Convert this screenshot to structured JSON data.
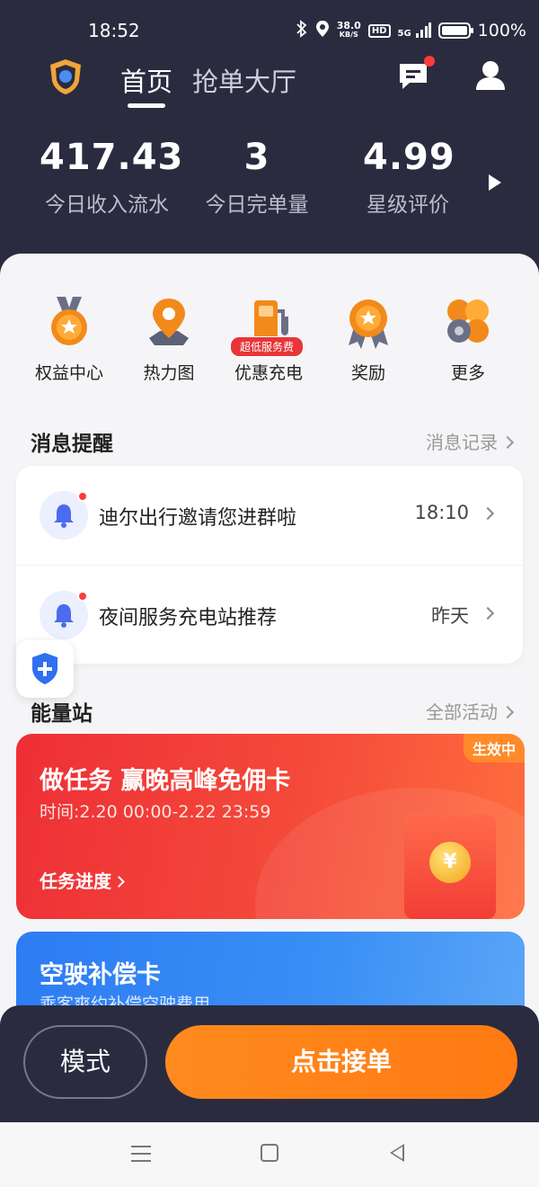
{
  "status_bar": {
    "time": "18:52",
    "net_speed_value": "38.0",
    "net_speed_unit": "KB/S",
    "hd": "HD",
    "signal": "5G",
    "battery": "100%"
  },
  "header": {
    "tabs": [
      {
        "label": "首页",
        "active": true
      },
      {
        "label": "抢单大厅",
        "active": false
      }
    ],
    "icons": [
      "logo-shield-icon",
      "message-icon",
      "user-icon"
    ]
  },
  "stats": [
    {
      "value": "417.43",
      "label": "今日收入流水"
    },
    {
      "value": "3",
      "label": "今日完单量"
    },
    {
      "value": "4.99",
      "label": "星级评价"
    }
  ],
  "quick_actions": [
    {
      "label": "权益中心",
      "icon": "medal-icon"
    },
    {
      "label": "热力图",
      "icon": "map-pin-icon"
    },
    {
      "label": "优惠充电",
      "icon": "charging-station-icon",
      "badge": "超低服务费"
    },
    {
      "label": "奖励",
      "icon": "award-icon"
    },
    {
      "label": "更多",
      "icon": "more-grid-icon"
    }
  ],
  "messages": {
    "title": "消息提醒",
    "link": "消息记录",
    "items": [
      {
        "text": "迪尔出行邀请您进群啦",
        "time": "18:10"
      },
      {
        "text": "夜间服务充电站推荐",
        "time": "昨天"
      }
    ]
  },
  "energy": {
    "title": "能量站",
    "link": "全部活动",
    "promo": {
      "tag": "生效中",
      "title": "做任务 赢晚高峰免佣卡",
      "time": "时间:2.20 00:00-2.22 23:59",
      "progress": "任务进度",
      "coin": "¥"
    },
    "card2": {
      "title": "空驶补偿卡",
      "subtitle": "乘客爽约补偿空驶费用"
    }
  },
  "bottom": {
    "mode_label": "模式",
    "accept_label": "点击接单"
  },
  "colors": {
    "header_bg": "#2b2b40",
    "accent_orange": "#ff8a1e",
    "promo_red": "#ee2f36",
    "card_blue": "#2d7cf3",
    "badge_red": "#e8353a"
  }
}
